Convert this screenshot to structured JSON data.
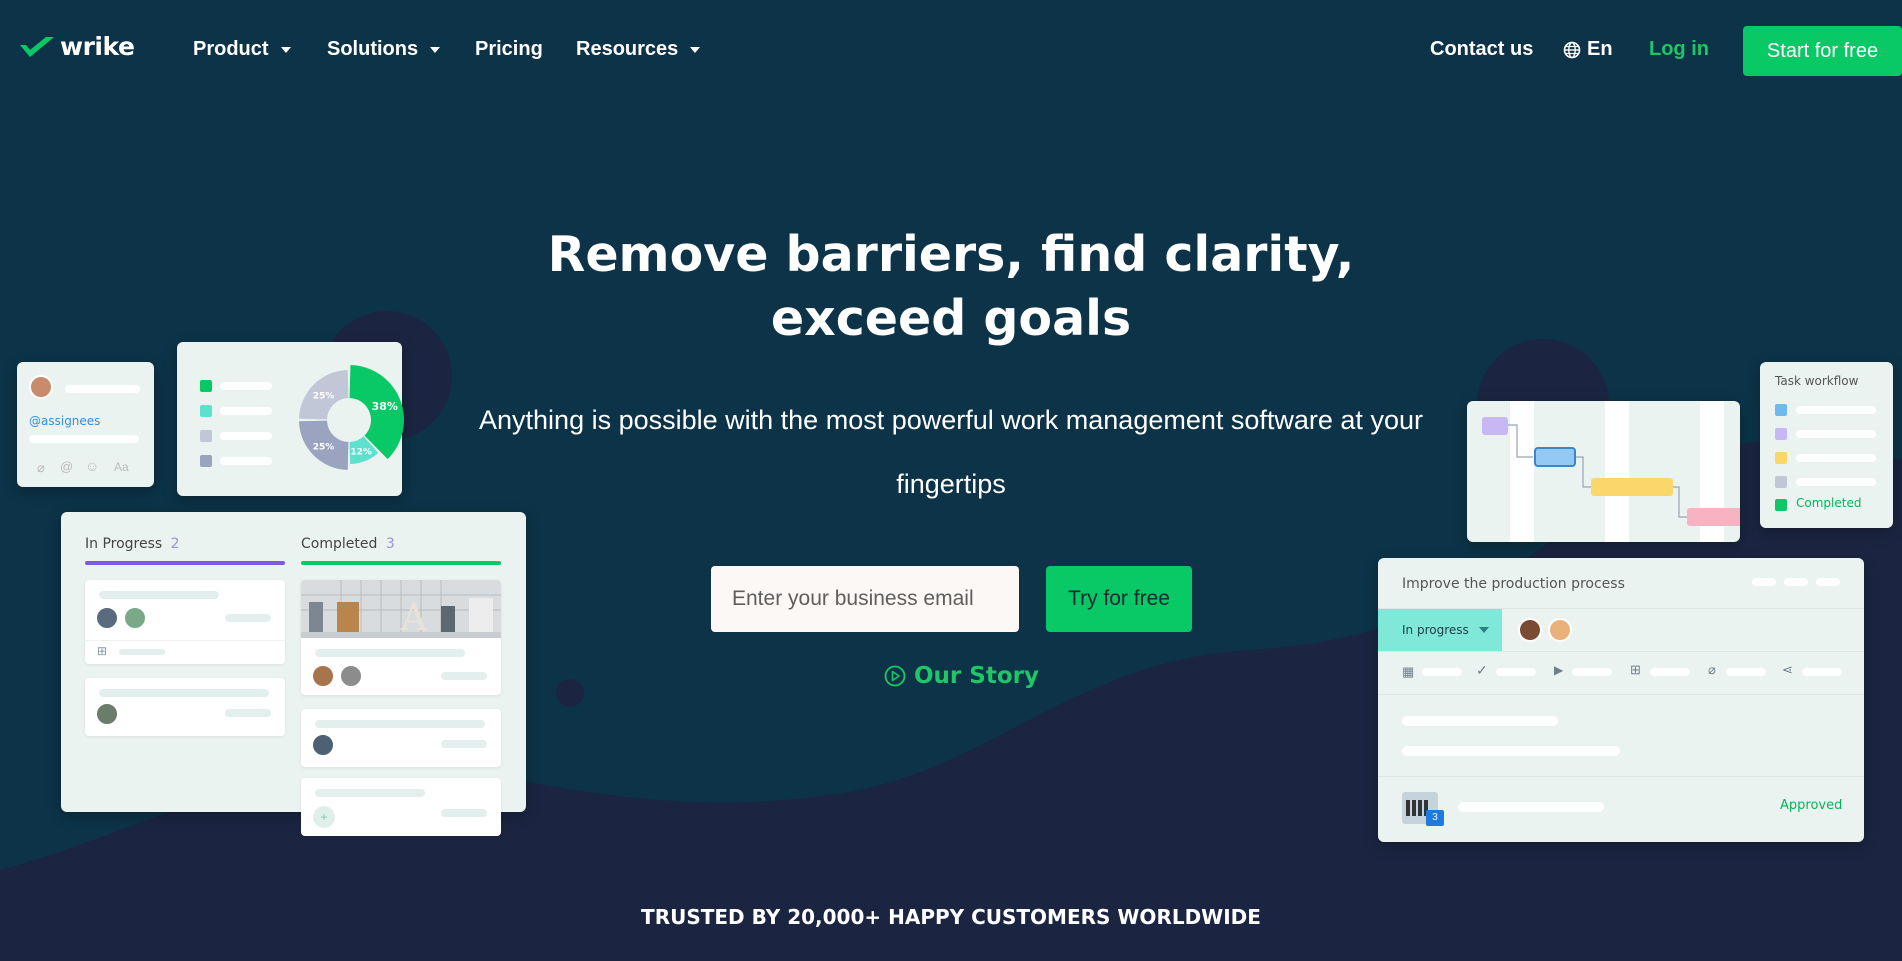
{
  "nav": {
    "logo_text": "wrike",
    "product": "Product",
    "solutions": "Solutions",
    "pricing": "Pricing",
    "resources": "Resources",
    "contact": "Contact us",
    "language": "En",
    "login": "Log in",
    "start": "Start for free"
  },
  "hero": {
    "title": "Remove barriers, find clarity, exceed goals",
    "subtitle": "Anything is possible with the most powerful work management software at your fingertips",
    "email_placeholder": "Enter your business email",
    "try_button": "Try for free",
    "our_story": "Our Story"
  },
  "left_cards": {
    "assignees_tag": "@assignees",
    "text_format_icon": "Aa",
    "donut": {
      "segments": [
        {
          "label": "38%",
          "value": 38,
          "color": "#08c965"
        },
        {
          "label": "12%",
          "value": 12,
          "color": "#5ee0cf"
        },
        {
          "label": "25%",
          "value": 25,
          "color": "#9aa3c0"
        },
        {
          "label": "25%",
          "value": 25,
          "color": "#c1c7d6"
        }
      ]
    },
    "board": {
      "col1_title": "In Progress",
      "col1_count": "2",
      "col2_title": "Completed",
      "col2_count": "3"
    }
  },
  "right_cards": {
    "workflow_title": "Task workflow",
    "workflow_completed": "Completed",
    "task_title": "Improve the production process",
    "status": "In progress",
    "approved": "Approved",
    "comment_count": "3"
  },
  "trusted": "TRUSTED BY 20,000+ HAPPY CUSTOMERS WORLDWIDE",
  "colors": {
    "background": "#0c3347",
    "wave": "#1b2541",
    "accent": "#08c965",
    "purple": "#7b5ae6"
  }
}
